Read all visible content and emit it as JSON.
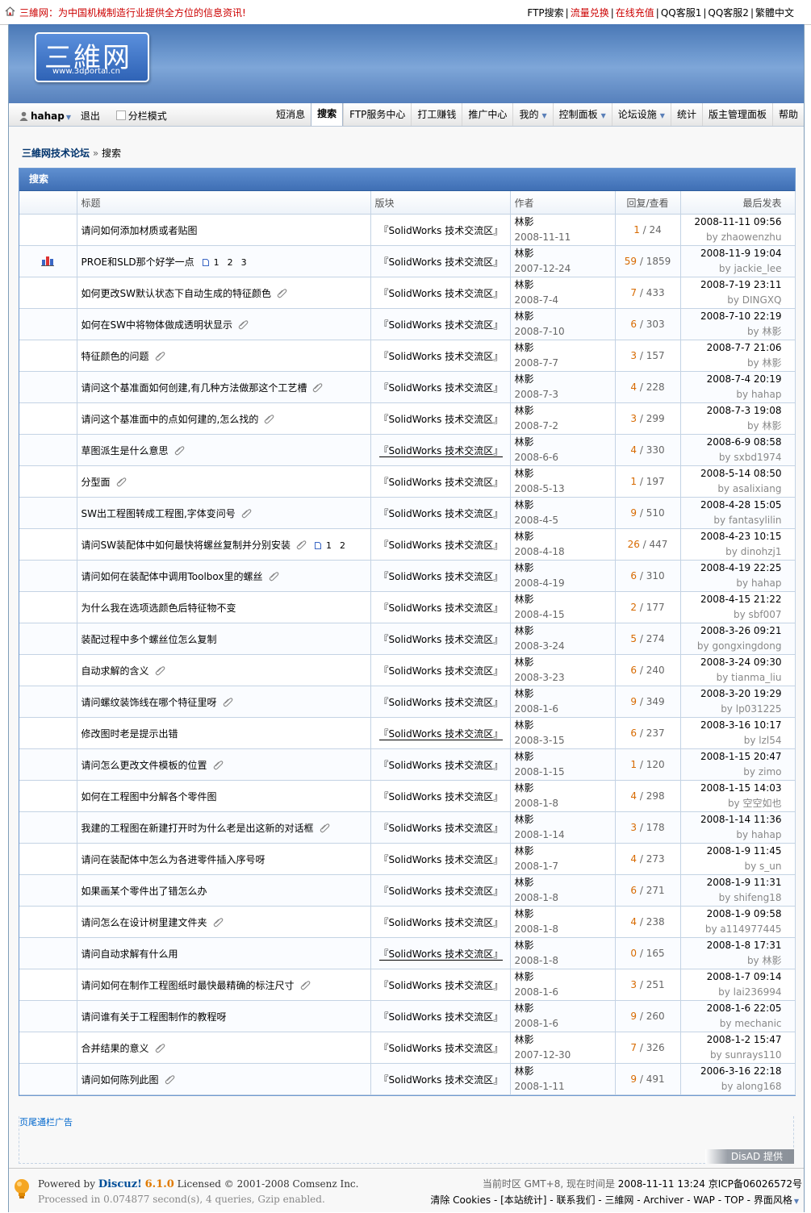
{
  "topbar": {
    "slogan": "三維网：为中国机械制造行业提供全方位的信息资讯!",
    "links": [
      {
        "label": "FTP搜索",
        "red": false
      },
      {
        "label": "流量兑换",
        "red": true
      },
      {
        "label": "在线充值",
        "red": true
      },
      {
        "label": "QQ客服1",
        "red": false
      },
      {
        "label": "QQ客服2",
        "red": false
      },
      {
        "label": "繁體中文",
        "red": false
      }
    ]
  },
  "logo": {
    "big": "三維网",
    "small": "www.3dportal.cn"
  },
  "nav": {
    "username": "hahap",
    "logout": "退出",
    "split_mode": "分栏模式",
    "menu": [
      {
        "label": "短消息",
        "dd": false,
        "active": false
      },
      {
        "label": "搜索",
        "dd": false,
        "active": true
      },
      {
        "label": "FTP服务中心",
        "dd": false,
        "active": false
      },
      {
        "label": "打工赚钱",
        "dd": false,
        "active": false
      },
      {
        "label": "推广中心",
        "dd": false,
        "active": false
      },
      {
        "label": "我的",
        "dd": true,
        "active": false
      },
      {
        "label": "控制面板",
        "dd": true,
        "active": false
      },
      {
        "label": "论坛设施",
        "dd": true,
        "active": false
      },
      {
        "label": "统计",
        "dd": false,
        "active": false
      },
      {
        "label": "版主管理面板",
        "dd": false,
        "active": false
      },
      {
        "label": "帮助",
        "dd": false,
        "active": false
      }
    ]
  },
  "breadcrumb": {
    "home": "三維网技术论坛",
    "sep": "»",
    "current": "搜索"
  },
  "search": {
    "title": "搜索",
    "columns": {
      "subject": "标题",
      "forum": "版块",
      "author": "作者",
      "stats": "回复/查看",
      "last": "最后发表"
    },
    "rows": [
      {
        "icon": "",
        "subject": "请问如何添加材质或者贴图",
        "attach": false,
        "pages": [],
        "forum": "『SolidWorks 技术交流区』",
        "forum_ul": false,
        "author": "林影",
        "date": "2008-11-11",
        "replies": "1",
        "views": "24",
        "last_time": "2008-11-11 09:56",
        "last_by": "zhaowenzhu"
      },
      {
        "icon": "poll",
        "subject": "PROE和SLD那个好学一点",
        "attach": false,
        "pages": [
          "1",
          "2",
          "3"
        ],
        "forum": "『SolidWorks 技术交流区』",
        "forum_ul": false,
        "author": "林影",
        "date": "2007-12-24",
        "replies": "59",
        "views": "1859",
        "last_time": "2008-11-9 19:04",
        "last_by": "jackie_lee"
      },
      {
        "icon": "",
        "subject": "如何更改SW默认状态下自动生成的特征颜色",
        "attach": true,
        "pages": [],
        "forum": "『SolidWorks 技术交流区』",
        "forum_ul": false,
        "author": "林影",
        "date": "2008-7-4",
        "replies": "7",
        "views": "433",
        "last_time": "2008-7-19 23:11",
        "last_by": "DINGXQ"
      },
      {
        "icon": "",
        "subject": "如何在SW中将物体做成透明状显示",
        "attach": true,
        "pages": [],
        "forum": "『SolidWorks 技术交流区』",
        "forum_ul": false,
        "author": "林影",
        "date": "2008-7-10",
        "replies": "6",
        "views": "303",
        "last_time": "2008-7-10 22:19",
        "last_by": "林影"
      },
      {
        "icon": "",
        "subject": "特征颜色的问题",
        "attach": true,
        "pages": [],
        "forum": "『SolidWorks 技术交流区』",
        "forum_ul": false,
        "author": "林影",
        "date": "2008-7-7",
        "replies": "3",
        "views": "157",
        "last_time": "2008-7-7 21:06",
        "last_by": "林影"
      },
      {
        "icon": "",
        "subject": "请问这个基准面如何创建,有几种方法做那这个工艺槽",
        "attach": true,
        "pages": [],
        "forum": "『SolidWorks 技术交流区』",
        "forum_ul": false,
        "author": "林影",
        "date": "2008-7-3",
        "replies": "4",
        "views": "228",
        "last_time": "2008-7-4 20:19",
        "last_by": "hahap"
      },
      {
        "icon": "",
        "subject": "请问这个基准面中的点如何建的,怎么找的",
        "attach": true,
        "pages": [],
        "forum": "『SolidWorks 技术交流区』",
        "forum_ul": false,
        "author": "林影",
        "date": "2008-7-2",
        "replies": "3",
        "views": "299",
        "last_time": "2008-7-3 19:08",
        "last_by": "林影"
      },
      {
        "icon": "",
        "subject": "草图派生是什么意思",
        "attach": true,
        "pages": [],
        "forum": "『SolidWorks 技术交流区』",
        "forum_ul": true,
        "author": "林影",
        "date": "2008-6-6",
        "replies": "4",
        "views": "330",
        "last_time": "2008-6-9 08:58",
        "last_by": "sxbd1974"
      },
      {
        "icon": "",
        "subject": "分型面",
        "attach": true,
        "pages": [],
        "forum": "『SolidWorks 技术交流区』",
        "forum_ul": false,
        "author": "林影",
        "date": "2008-5-13",
        "replies": "1",
        "views": "197",
        "last_time": "2008-5-14 08:50",
        "last_by": "asalixiang"
      },
      {
        "icon": "",
        "subject": "SW出工程图转成工程图,字体变问号",
        "attach": true,
        "pages": [],
        "forum": "『SolidWorks 技术交流区』",
        "forum_ul": false,
        "author": "林影",
        "date": "2008-4-5",
        "replies": "9",
        "views": "510",
        "last_time": "2008-4-28 15:05",
        "last_by": "fantasylilin"
      },
      {
        "icon": "",
        "subject": "请问SW装配体中如何最快将螺丝复制并分别安装",
        "attach": true,
        "pages": [
          "1",
          "2"
        ],
        "forum": "『SolidWorks 技术交流区』",
        "forum_ul": false,
        "author": "林影",
        "date": "2008-4-18",
        "replies": "26",
        "views": "447",
        "last_time": "2008-4-23 10:15",
        "last_by": "dinohzj1"
      },
      {
        "icon": "",
        "subject": "请问如何在装配体中调用Toolbox里的螺丝",
        "attach": true,
        "pages": [],
        "forum": "『SolidWorks 技术交流区』",
        "forum_ul": false,
        "author": "林影",
        "date": "2008-4-19",
        "replies": "6",
        "views": "310",
        "last_time": "2008-4-19 22:25",
        "last_by": "hahap"
      },
      {
        "icon": "",
        "subject": "为什么我在选项选颜色后特征物不变",
        "attach": false,
        "pages": [],
        "forum": "『SolidWorks 技术交流区』",
        "forum_ul": false,
        "author": "林影",
        "date": "2008-4-15",
        "replies": "2",
        "views": "177",
        "last_time": "2008-4-15 21:22",
        "last_by": "sbf007"
      },
      {
        "icon": "",
        "subject": "装配过程中多个螺丝位怎么复制",
        "attach": false,
        "pages": [],
        "forum": "『SolidWorks 技术交流区』",
        "forum_ul": false,
        "author": "林影",
        "date": "2008-3-24",
        "replies": "5",
        "views": "274",
        "last_time": "2008-3-26 09:21",
        "last_by": "gongxingdong"
      },
      {
        "icon": "",
        "subject": "自动求解的含义",
        "attach": true,
        "pages": [],
        "forum": "『SolidWorks 技术交流区』",
        "forum_ul": false,
        "author": "林影",
        "date": "2008-3-23",
        "replies": "6",
        "views": "240",
        "last_time": "2008-3-24 09:30",
        "last_by": "tianma_liu"
      },
      {
        "icon": "",
        "subject": "请问螺纹装饰线在哪个特征里呀",
        "attach": true,
        "pages": [],
        "forum": "『SolidWorks 技术交流区』",
        "forum_ul": false,
        "author": "林影",
        "date": "2008-1-6",
        "replies": "9",
        "views": "349",
        "last_time": "2008-3-20 19:29",
        "last_by": "lp031225"
      },
      {
        "icon": "",
        "subject": "修改图时老是提示出错",
        "attach": false,
        "pages": [],
        "forum": "『SolidWorks 技术交流区』",
        "forum_ul": true,
        "author": "林影",
        "date": "2008-3-15",
        "replies": "6",
        "views": "237",
        "last_time": "2008-3-16 10:17",
        "last_by": "lzl54"
      },
      {
        "icon": "",
        "subject": "请问怎么更改文件模板的位置",
        "attach": true,
        "pages": [],
        "forum": "『SolidWorks 技术交流区』",
        "forum_ul": false,
        "author": "林影",
        "date": "2008-1-15",
        "replies": "1",
        "views": "120",
        "last_time": "2008-1-15 20:47",
        "last_by": "zimo"
      },
      {
        "icon": "",
        "subject": "如何在工程图中分解各个零件图",
        "attach": false,
        "pages": [],
        "forum": "『SolidWorks 技术交流区』",
        "forum_ul": false,
        "author": "林影",
        "date": "2008-1-8",
        "replies": "4",
        "views": "298",
        "last_time": "2008-1-15 14:03",
        "last_by": "空空如也"
      },
      {
        "icon": "",
        "subject": "我建的工程图在新建打开时为什么老是出这新的对话框",
        "attach": true,
        "pages": [],
        "forum": "『SolidWorks 技术交流区』",
        "forum_ul": false,
        "author": "林影",
        "date": "2008-1-14",
        "replies": "3",
        "views": "178",
        "last_time": "2008-1-14 11:36",
        "last_by": "hahap"
      },
      {
        "icon": "",
        "subject": "请问在装配体中怎么为各进零件插入序号呀",
        "attach": false,
        "pages": [],
        "forum": "『SolidWorks 技术交流区』",
        "forum_ul": false,
        "author": "林影",
        "date": "2008-1-7",
        "replies": "4",
        "views": "273",
        "last_time": "2008-1-9 11:45",
        "last_by": "s_un"
      },
      {
        "icon": "",
        "subject": "如果画某个零件出了错怎么办",
        "attach": false,
        "pages": [],
        "forum": "『SolidWorks 技术交流区』",
        "forum_ul": false,
        "author": "林影",
        "date": "2008-1-8",
        "replies": "6",
        "views": "271",
        "last_time": "2008-1-9 11:31",
        "last_by": "shifeng18"
      },
      {
        "icon": "",
        "subject": "请问怎么在设计树里建文件夹",
        "attach": true,
        "pages": [],
        "forum": "『SolidWorks 技术交流区』",
        "forum_ul": false,
        "author": "林影",
        "date": "2008-1-8",
        "replies": "4",
        "views": "238",
        "last_time": "2008-1-9 09:58",
        "last_by": "a114977445"
      },
      {
        "icon": "",
        "subject": "请问自动求解有什么用",
        "attach": false,
        "pages": [],
        "forum": "『SolidWorks 技术交流区』",
        "forum_ul": true,
        "author": "林影",
        "date": "2008-1-8",
        "replies": "0",
        "views": "165",
        "last_time": "2008-1-8 17:31",
        "last_by": "林影"
      },
      {
        "icon": "",
        "subject": "请问如何在制作工程图纸时最快最精确的标注尺寸",
        "attach": true,
        "pages": [],
        "forum": "『SolidWorks 技术交流区』",
        "forum_ul": false,
        "author": "林影",
        "date": "2008-1-6",
        "replies": "3",
        "views": "251",
        "last_time": "2008-1-7 09:14",
        "last_by": "lai236994"
      },
      {
        "icon": "",
        "subject": "请问谁有关于工程图制作的教程呀",
        "attach": false,
        "pages": [],
        "forum": "『SolidWorks 技术交流区』",
        "forum_ul": false,
        "author": "林影",
        "date": "2008-1-6",
        "replies": "9",
        "views": "260",
        "last_time": "2008-1-6 22:05",
        "last_by": "mechanic"
      },
      {
        "icon": "",
        "subject": "合并结果的意义",
        "attach": true,
        "pages": [],
        "forum": "『SolidWorks 技术交流区』",
        "forum_ul": false,
        "author": "林影",
        "date": "2007-12-30",
        "replies": "7",
        "views": "326",
        "last_time": "2008-1-2 15:47",
        "last_by": "sunrays110"
      },
      {
        "icon": "",
        "subject": "请问如何陈列此图",
        "attach": true,
        "pages": [],
        "forum": "『SolidWorks 技术交流区』",
        "forum_ul": false,
        "author": "林影",
        "date": "2008-1-11",
        "replies": "9",
        "views": "491",
        "last_time": "2006-3-16 22:18",
        "last_by": "along168"
      }
    ]
  },
  "ad": {
    "label": "页尾通栏广告",
    "provider": "DisAD 提供"
  },
  "footer": {
    "powered": "Powered by",
    "product": "Discuz!",
    "version": "6.1.0",
    "license": "Licensed © 2001-2008 Comsenz Inc.",
    "processed": "Processed in 0.074877 second(s), 4 queries, Gzip enabled.",
    "tz_label": "当前时区  GMT+8, 现在时间是",
    "now": "2008-11-11 13:24",
    "icp": "京ICP备06026572号",
    "links": [
      "清除 Cookies",
      "[本站统计]",
      "联系我们",
      "三維网",
      "Archiver",
      "WAP",
      "TOP",
      "界面风格"
    ]
  },
  "colors": {
    "accent": "#3f6fb4",
    "link_red": "#cc0000",
    "replies": "#d76a00"
  }
}
